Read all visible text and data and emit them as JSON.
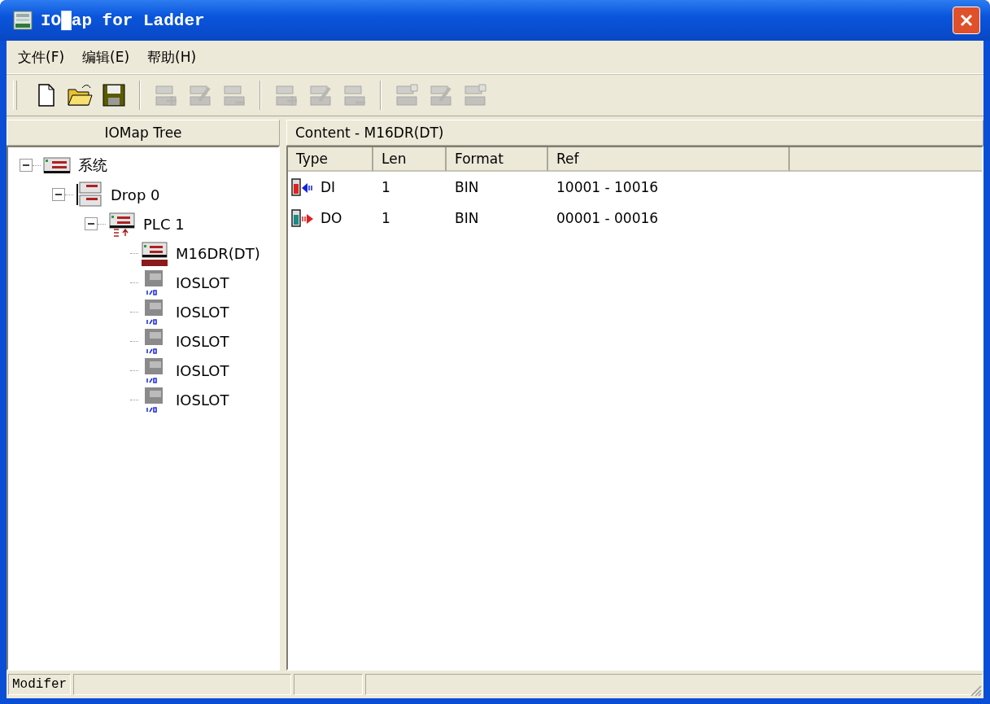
{
  "window": {
    "title": "IO█ap for Ladder"
  },
  "menu": [
    {
      "label": "文件(F)"
    },
    {
      "label": "编辑(E)"
    },
    {
      "label": "帮助(H)"
    }
  ],
  "toolbar": [
    {
      "buttons": [
        {
          "kind": "new",
          "disabled": false
        },
        {
          "kind": "open",
          "disabled": false
        },
        {
          "kind": "save",
          "disabled": false
        }
      ]
    },
    {
      "buttons": [
        {
          "kind": "tree-add",
          "disabled": true
        },
        {
          "kind": "tree-edit",
          "disabled": true
        },
        {
          "kind": "tree-remove",
          "disabled": true
        }
      ]
    },
    {
      "buttons": [
        {
          "kind": "item-add",
          "disabled": true
        },
        {
          "kind": "item-edit",
          "disabled": true
        },
        {
          "kind": "item-remove",
          "disabled": true
        }
      ]
    },
    {
      "buttons": [
        {
          "kind": "slot-insert",
          "disabled": true
        },
        {
          "kind": "slot-edit",
          "disabled": true
        },
        {
          "kind": "slot-move",
          "disabled": true
        }
      ]
    }
  ],
  "tree_panel": {
    "title": "IOMap Tree",
    "items": [
      {
        "label": "系统",
        "kind": "system",
        "expanded": true,
        "children": [
          {
            "label": "Drop 0",
            "kind": "drop",
            "expanded": true,
            "children": [
              {
                "label": "PLC  1",
                "kind": "plc",
                "expanded": true,
                "children": [
                  {
                    "label": "M16DR(DT)",
                    "kind": "module"
                  },
                  {
                    "label": "IOSLOT",
                    "kind": "ioslot"
                  },
                  {
                    "label": "IOSLOT",
                    "kind": "ioslot"
                  },
                  {
                    "label": "IOSLOT",
                    "kind": "ioslot"
                  },
                  {
                    "label": "IOSLOT",
                    "kind": "ioslot"
                  },
                  {
                    "label": "IOSLOT",
                    "kind": "ioslot"
                  }
                ]
              }
            ]
          }
        ]
      }
    ]
  },
  "content_panel": {
    "title": "Content - M16DR(DT)",
    "columns": [
      "Type",
      "Len",
      "Format",
      "Ref"
    ],
    "rows": [
      {
        "kind": "input",
        "type": "DI",
        "len": "1",
        "format": "BIN",
        "ref": "10001 - 10016"
      },
      {
        "kind": "output",
        "type": "DO",
        "len": "1",
        "format": "BIN",
        "ref": "00001 - 00016"
      }
    ]
  },
  "status_bar": {
    "panels": [
      "Modifer"
    ]
  }
}
